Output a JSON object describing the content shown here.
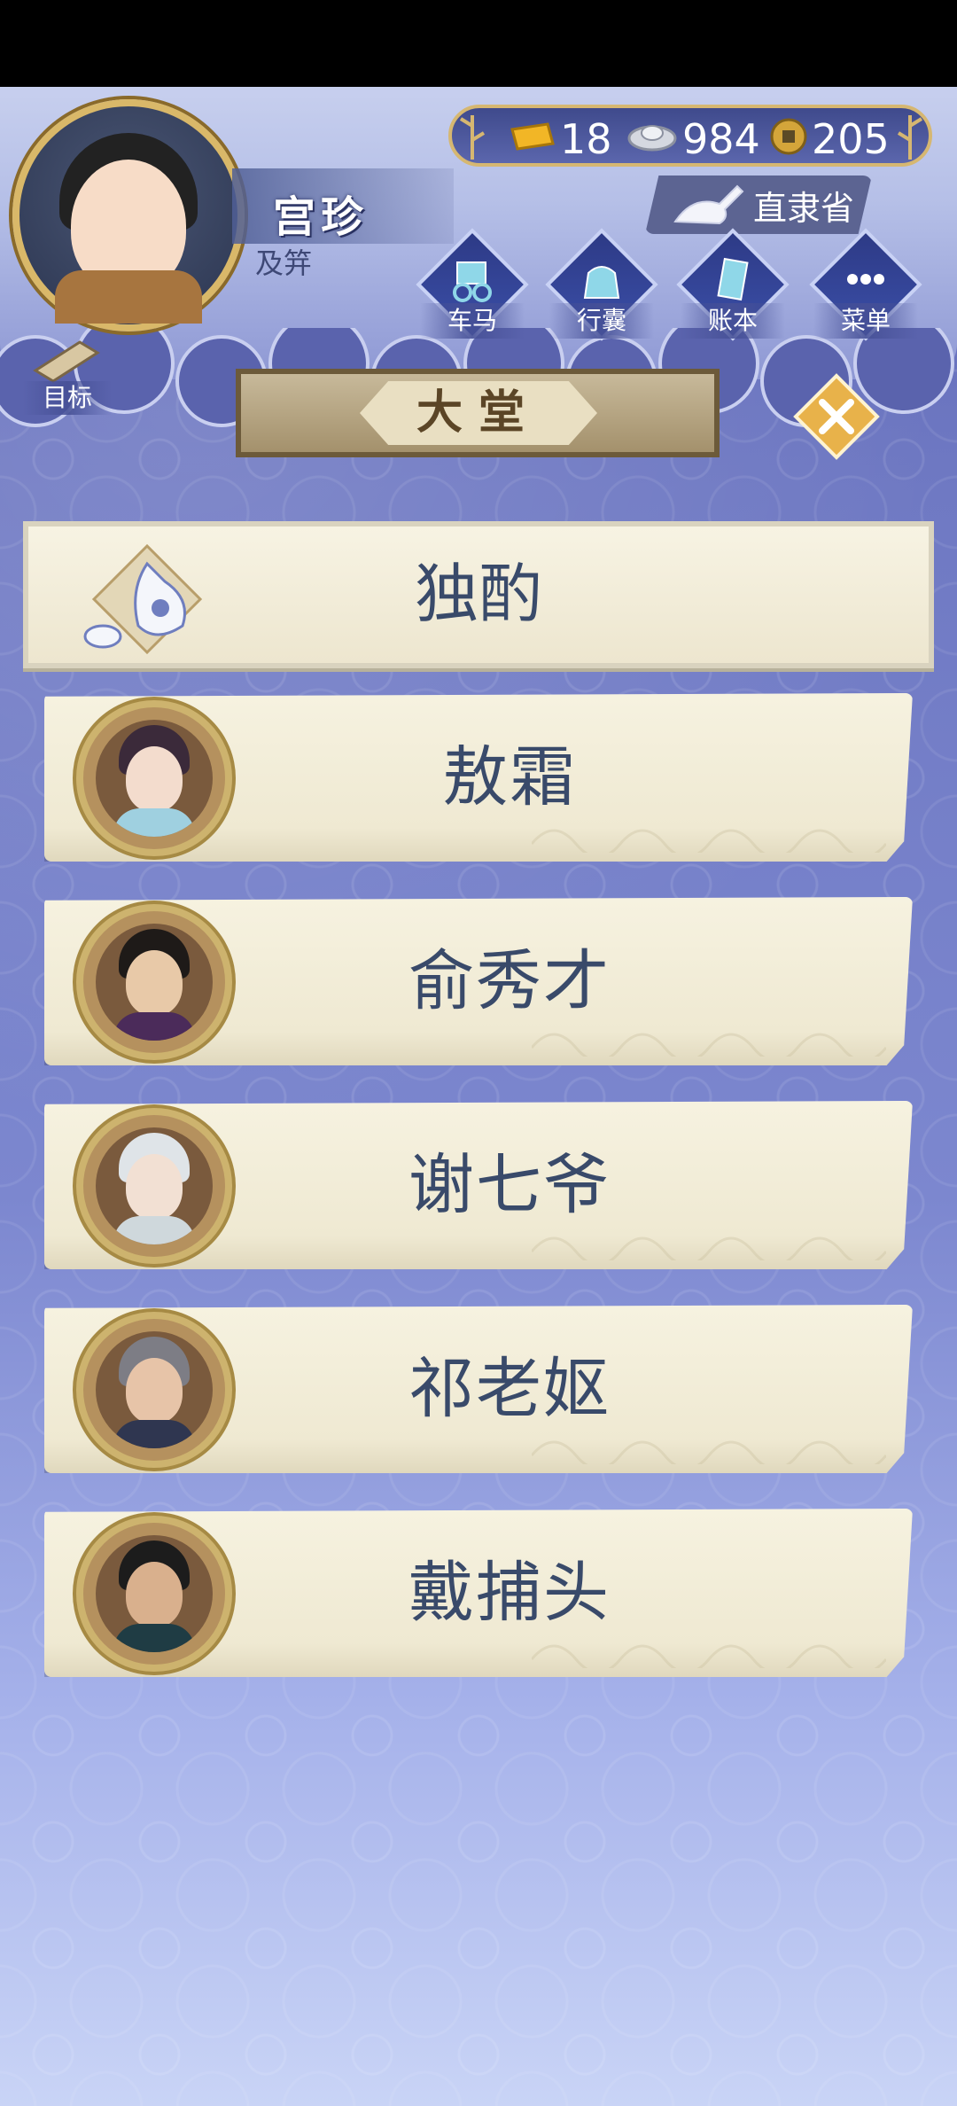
{
  "player": {
    "name": "宫珍",
    "rank": "及笄"
  },
  "currency": {
    "gold": "18",
    "silver": "984",
    "coins": "205"
  },
  "location": "直隶省",
  "menu": [
    {
      "label": "车马",
      "icon": "carriage-icon"
    },
    {
      "label": "行囊",
      "icon": "bag-icon"
    },
    {
      "label": "账本",
      "icon": "ledger-icon"
    },
    {
      "label": "菜单",
      "icon": "more-icon"
    }
  ],
  "goal": {
    "label": "目标",
    "icon": "scroll-icon"
  },
  "hall": {
    "title": "大堂"
  },
  "list": {
    "first": {
      "label": "独酌",
      "icon": "wine-vase-icon"
    },
    "characters": [
      {
        "name": "敖霜",
        "hair": "#3b2a3a",
        "skin": "#f3dccd",
        "clothes": "#9fd0e0"
      },
      {
        "name": "俞秀才",
        "hair": "#1e1a18",
        "skin": "#e8c9a8",
        "clothes": "#4b2b5a"
      },
      {
        "name": "谢七爷",
        "hair": "#dfe4e8",
        "skin": "#f2e0d3",
        "clothes": "#cfd8dc"
      },
      {
        "name": "祁老妪",
        "hair": "#7d7d85",
        "skin": "#e7c4a8",
        "clothes": "#2f3650"
      },
      {
        "name": "戴捕头",
        "hair": "#1c1c1c",
        "skin": "#d9b08d",
        "clothes": "#1f3c44"
      }
    ]
  }
}
